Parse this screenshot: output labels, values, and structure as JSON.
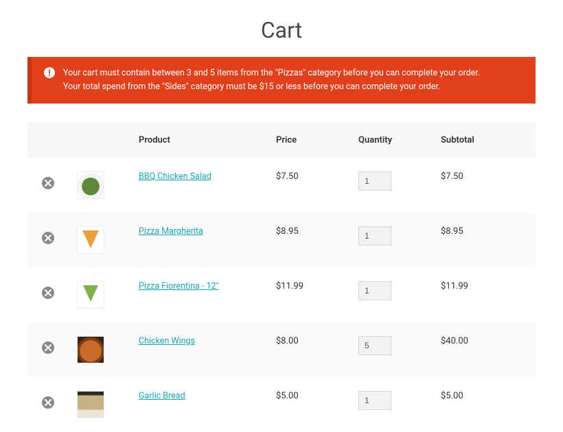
{
  "title": "Cart",
  "alert": {
    "line1": "Your cart must contain between 3 and 5 items from the \"Pizzas\" category before you can complete your order.",
    "line2": "Your total spend from the \"Sides\" category must be $15 or less before you can complete your order."
  },
  "columns": {
    "product": "Product",
    "price": "Price",
    "quantity": "Quantity",
    "subtotal": "Subtotal"
  },
  "items": [
    {
      "name": "BBQ Chicken Salad",
      "price": "$7.50",
      "qty": "1",
      "subtotal": "$7.50",
      "thumb": "thumb-salad"
    },
    {
      "name": "Pizza Margherita",
      "price": "$8.95",
      "qty": "1",
      "subtotal": "$8.95",
      "thumb": "thumb-pizza-slice"
    },
    {
      "name": "Pizza Fiorentina - 12\"",
      "price": "$11.99",
      "qty": "1",
      "subtotal": "$11.99",
      "thumb": "thumb-pizza-green"
    },
    {
      "name": "Chicken Wings",
      "price": "$8.00",
      "qty": "5",
      "subtotal": "$40.00",
      "thumb": "thumb-wings"
    },
    {
      "name": "Garlic Bread",
      "price": "$5.00",
      "qty": "1",
      "subtotal": "$5.00",
      "thumb": "thumb-bread"
    }
  ]
}
